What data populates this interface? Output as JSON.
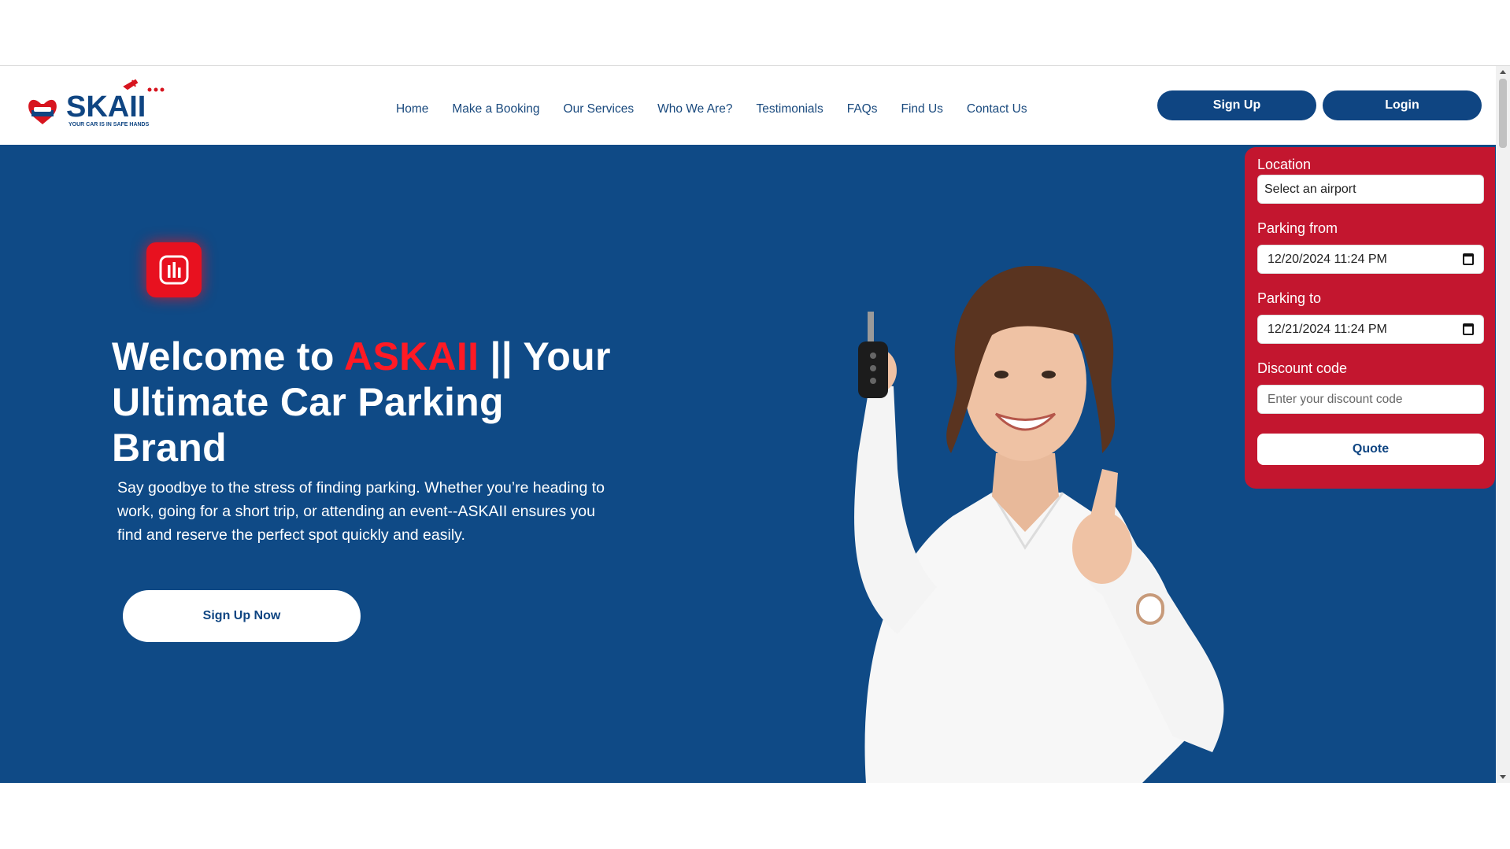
{
  "brand": {
    "logo_text": "SKAII",
    "tagline": "YOUR CAR IS IN SAFE HANDS"
  },
  "nav": {
    "items": [
      "Home",
      "Make a Booking",
      "Our Services",
      "Who We Are?",
      "Testimonials",
      "FAQs",
      "Find Us",
      "Contact Us"
    ]
  },
  "header_buttons": {
    "signup": "Sign Up",
    "login": "Login"
  },
  "hero": {
    "title_prefix": "Welcome to ",
    "title_brand": "ASKAII",
    "title_rest": " || Your Ultimate Car Parking Brand",
    "description": "Say goodbye to the stress of finding parking. Whether you’re heading to work, going for a short trip, or attending an event--ASKAII ensures you find and reserve the perfect spot quickly and easily.",
    "cta": "Sign Up Now",
    "feature_icon": "bar-chart-icon"
  },
  "booking_form": {
    "location_label": "Location",
    "location_value": "Select an airport",
    "parking_from_label": "Parking from",
    "parking_from_value": "12/20/2024 11:24 PM",
    "parking_to_label": "Parking to",
    "parking_to_value": "12/21/2024 11:24 PM",
    "discount_label": "Discount code",
    "discount_placeholder": "Enter your discount code",
    "quote_button": "Quote"
  },
  "colors": {
    "primary_blue": "#0f4a86",
    "accent_red": "#ff1a25",
    "form_red": "#c3162f"
  }
}
